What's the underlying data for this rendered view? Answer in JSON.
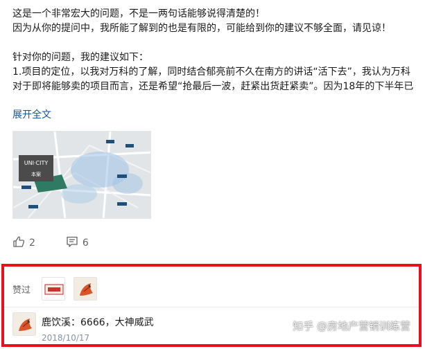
{
  "answer": {
    "lines": [
      "这是一个非常宏大的问题，不是一两句话能够说得清楚的！",
      "因为从你的提问中，我所能了解到的也是有限的，可能给到你的建议不够全面，请见谅！",
      "",
      "针对你的问题，我的建议如下：",
      "1.项目的定位，以我对万科的了解，同时结合郁亮前不久在南方的讲话“活下去”，我认为万科",
      "对于即将能够卖的项目而言，还是希望“抢最后一波，赶紧出货赶紧卖”。因为18年的下半年已"
    ],
    "expand_label": "展开全文"
  },
  "map_image": {
    "brand_text": "UNI·CITY",
    "sub_text": "本案",
    "icon": "map-thumbnail"
  },
  "actions": {
    "like_count": "2",
    "comment_count": "6",
    "like_icon": "thumbs-up-icon",
    "comment_icon": "comment-icon"
  },
  "liked": {
    "label": "赞过"
  },
  "comment": {
    "author": "鹿饮溪",
    "text": "6666，大神威武",
    "date": "2018/10/17"
  },
  "watermark": "知乎 @房地产营销训练营",
  "colors": {
    "link": "#175199",
    "highlight_border": "#e8101b",
    "meta_gray": "#8590a6"
  }
}
